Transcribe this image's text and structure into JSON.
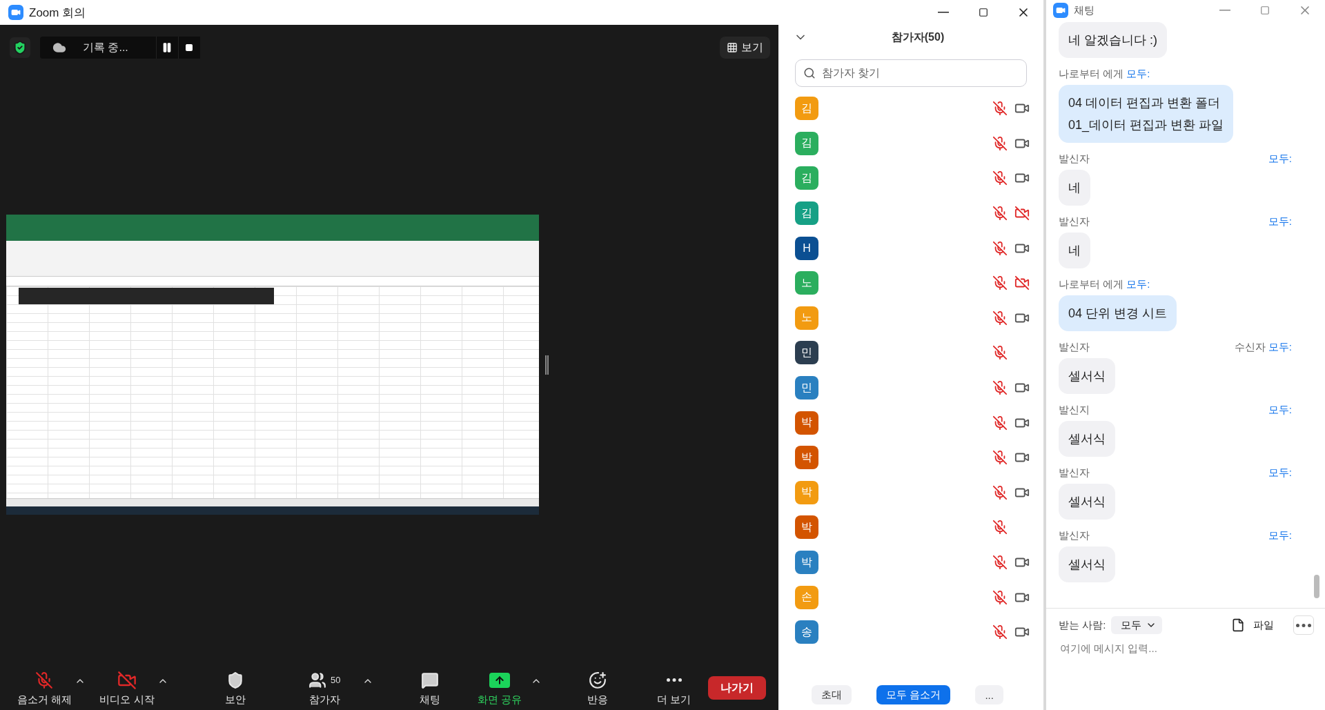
{
  "window": {
    "title": "Zoom 회의"
  },
  "meeting_bar": {
    "recording": "기록 중...",
    "view_button": "보기"
  },
  "participants": {
    "title": "참가자(50)",
    "search": {
      "placeholder": "참가자 찾기"
    },
    "items": [
      {
        "initial": "김",
        "color": "#f29b11",
        "mic_muted": true,
        "camera_off": false
      },
      {
        "initial": "김",
        "color": "#2bae5e",
        "mic_muted": true,
        "camera_off": false
      },
      {
        "initial": "김",
        "color": "#2bae5e",
        "mic_muted": true,
        "camera_off": false
      },
      {
        "initial": "김",
        "color": "#16a085",
        "mic_muted": true,
        "camera_off": true
      },
      {
        "initial": "H",
        "color": "#0b4f92",
        "mic_muted": true,
        "camera_off": false
      },
      {
        "initial": "노",
        "color": "#2bae5e",
        "mic_muted": true,
        "camera_off": true
      },
      {
        "initial": "노",
        "color": "#f29b11",
        "mic_muted": true,
        "camera_off": false
      },
      {
        "initial": "민",
        "color": "#2c3e50",
        "mic_muted": true
      },
      {
        "initial": "민",
        "color": "#2a80c0",
        "mic_muted": true,
        "camera_off": false
      },
      {
        "initial": "박",
        "color": "#d35400",
        "mic_muted": true,
        "camera_off": false
      },
      {
        "initial": "박",
        "color": "#d35400",
        "mic_muted": true,
        "camera_off": false
      },
      {
        "initial": "박",
        "color": "#f29b11",
        "mic_muted": true,
        "camera_off": false
      },
      {
        "initial": "박",
        "color": "#d35400",
        "mic_muted": true
      },
      {
        "initial": "박",
        "color": "#2a80c0",
        "mic_muted": true,
        "camera_off": false
      },
      {
        "initial": "손",
        "color": "#f29b11",
        "mic_muted": true,
        "camera_off": false
      },
      {
        "initial": "송",
        "color": "#2a80c0",
        "mic_muted": true,
        "camera_off": false
      }
    ],
    "buttons": [
      {
        "label": "초대",
        "kind": "plain"
      },
      {
        "label": "모두 음소거",
        "kind": "primary"
      },
      {
        "label": "...",
        "kind": "plain"
      }
    ]
  },
  "toolbar": {
    "items": [
      {
        "label": "음소거 해제",
        "kind": "mic",
        "muted": true,
        "menu": true
      },
      {
        "label": "비디오 시작",
        "kind": "video",
        "muted": true,
        "menu": true
      },
      {
        "label": "보안",
        "kind": "security"
      },
      {
        "label": "참가자",
        "kind": "participants",
        "count": "50",
        "menu": true
      },
      {
        "label": "채팅",
        "kind": "chat"
      },
      {
        "label": "화면 공유",
        "kind": "share",
        "highlighted": true,
        "menu": true
      },
      {
        "label": "반응",
        "kind": "reactions"
      },
      {
        "label": "더 보기",
        "kind": "more"
      }
    ],
    "leave_button": "나가기"
  },
  "chat": {
    "title": "채팅",
    "messages": [
      {
        "own": false,
        "lines": [
          "네 알겠습니다 :)"
        ]
      },
      {
        "own": true,
        "sender": "나로부터 에게",
        "recipient": "모두:",
        "lines": [
          "04 데이터 편집과 변환 폴더",
          "01_데이터 편집과 변환 파일"
        ]
      },
      {
        "own": false,
        "sender": "발신자",
        "recipient": "모두:",
        "lines": [
          "네"
        ]
      },
      {
        "own": false,
        "sender": "발신자",
        "recipient": "모두:",
        "lines": [
          "네"
        ]
      },
      {
        "own": true,
        "sender": "나로부터 에게",
        "recipient": "모두:",
        "lines": [
          "04 단위 변경 시트"
        ]
      },
      {
        "own": false,
        "sender": "발신자",
        "recipient_prefix": "수신자",
        "recipient": "모두:",
        "lines": [
          "셀서식"
        ]
      },
      {
        "own": false,
        "sender": "발신지",
        "recipient": "모두:",
        "lines": [
          "셀서식"
        ]
      },
      {
        "own": false,
        "sender": "발신자",
        "recipient": "모두:",
        "lines": [
          "셀서식"
        ]
      },
      {
        "own": false,
        "sender": "발신자",
        "recipient": "모두:",
        "lines": [
          "셀서식"
        ]
      }
    ],
    "recipient_label": "받는 사람:",
    "recipient": "모두",
    "file_button": "파일",
    "placeholder": "여기에 메시지 입력..."
  }
}
